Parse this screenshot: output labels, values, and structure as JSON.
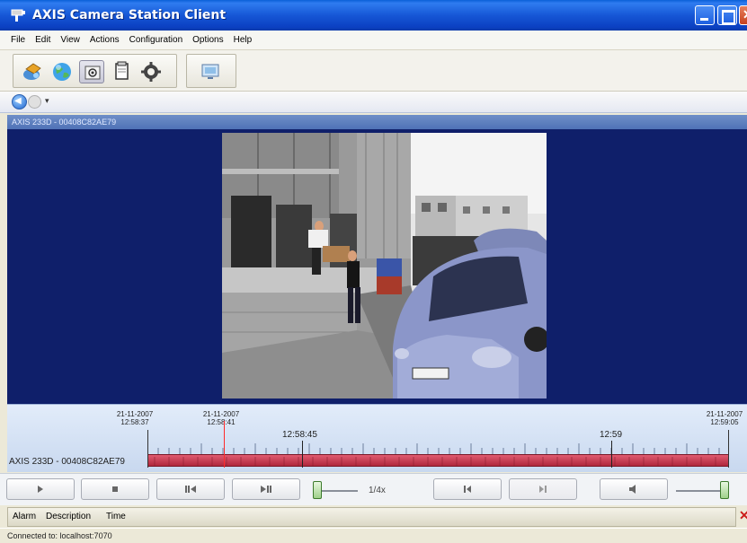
{
  "window": {
    "title": "AXIS Camera Station Client"
  },
  "menu": {
    "items": [
      "File",
      "Edit",
      "View",
      "Actions",
      "Configuration",
      "Options",
      "Help"
    ]
  },
  "nav": {
    "dropdown_glyph": "▾"
  },
  "camera": {
    "header": "AXIS 233D - 00408C82AE79"
  },
  "timeline": {
    "dates": [
      {
        "date": "21-11-2007",
        "time": "12:58:37"
      },
      {
        "date": "21-11-2007",
        "time": "12:58:41"
      },
      {
        "date": "21-11-2007",
        "time": "12:59:05"
      }
    ],
    "markers": [
      "12:58:45",
      "12:59"
    ],
    "track_label": "AXIS 233D - 00408C82AE79"
  },
  "controls": {
    "speed": "1/4x"
  },
  "alarm": {
    "columns": [
      "Alarm",
      "Description",
      "Time"
    ],
    "close_glyph": "✕"
  },
  "status": {
    "connection": "Connected to: localhost:7070"
  },
  "colors": {
    "title_bar": "#1657d6",
    "video_background": "#0f1f6a",
    "timeline_track": "#c8384e",
    "cursor_line": "#ff2a2a"
  }
}
